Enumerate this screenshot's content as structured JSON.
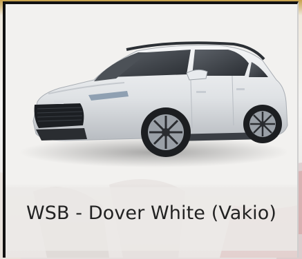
{
  "variant": {
    "label": "WSB - Dover White (Vakio)"
  },
  "colors": {
    "car_body": "#e6e8ea",
    "accent_band": "#c8a24a",
    "text": "#222222"
  }
}
